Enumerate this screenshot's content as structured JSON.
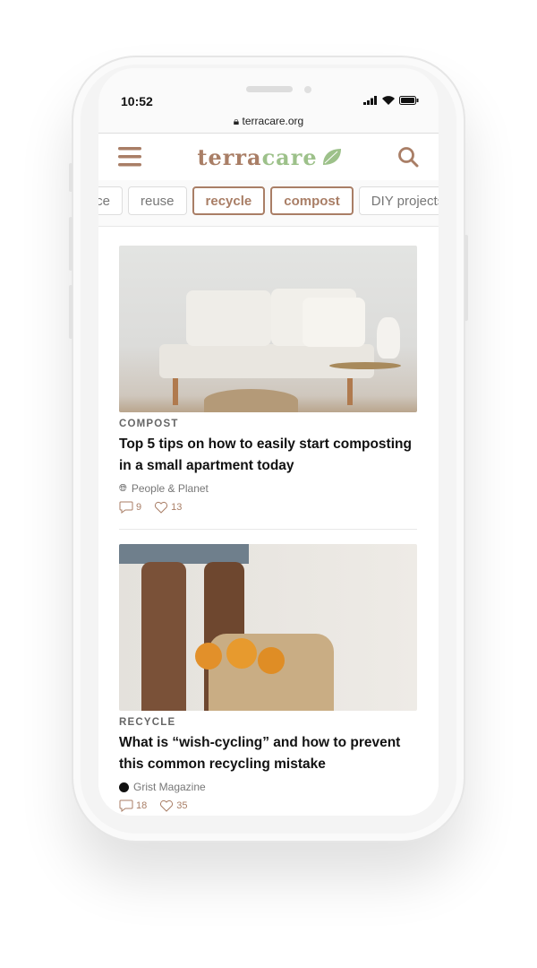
{
  "status_bar": {
    "time": "10:52"
  },
  "browser": {
    "url": "terracare.org"
  },
  "header": {
    "logo_part1": "terra",
    "logo_part2": "care"
  },
  "categories": [
    {
      "label": "reduce",
      "visible": "uce"
    },
    {
      "label": "reuse"
    },
    {
      "label": "recycle",
      "selected": true
    },
    {
      "label": "compost",
      "selected": true
    },
    {
      "label": "DIY projects",
      "visible": "DIY project"
    }
  ],
  "articles": [
    {
      "category": "COMPOST",
      "title": "Top 5 tips on how to easily start composting in a small apartment today",
      "source": "People & Planet",
      "comments": "9",
      "likes": "13"
    },
    {
      "category": "RECYCLE",
      "title": "What is “wish-cycling” and how to prevent this common recycling mistake",
      "source": "Grist Magazine",
      "comments": "18",
      "likes": "35"
    }
  ],
  "colors": {
    "accent": "#a97e66",
    "leaf": "#9dc18a"
  }
}
